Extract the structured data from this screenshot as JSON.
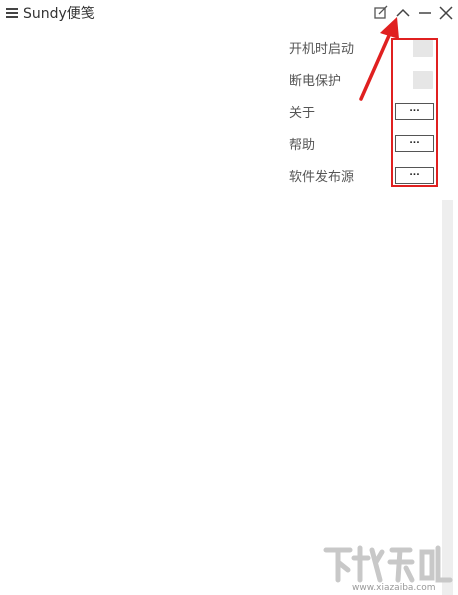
{
  "app": {
    "title": "Sundy便笺"
  },
  "window_controls": {
    "new_note_icon": "edit-icon",
    "collapse_icon": "chevron-up-icon",
    "minimize_icon": "minimize-icon",
    "close_icon": "close-icon"
  },
  "settings": {
    "rows": [
      {
        "label": "开机时启动",
        "control": "toggle",
        "enabled": false
      },
      {
        "label": "断电保护",
        "control": "toggle",
        "enabled": false
      },
      {
        "label": "关于",
        "control": "button",
        "button_label": "..."
      },
      {
        "label": "帮助",
        "control": "button",
        "button_label": "..."
      },
      {
        "label": "软件发布源",
        "control": "button",
        "button_label": "..."
      }
    ]
  },
  "annotation": {
    "color": "#e02020"
  },
  "watermark": {
    "text": "www.xiazaiba.com"
  }
}
